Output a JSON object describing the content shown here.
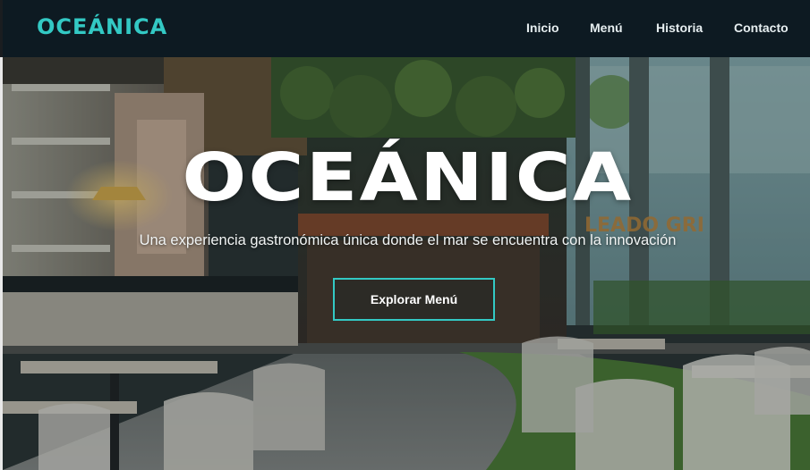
{
  "brand": {
    "logo": "OCEÁNICA",
    "accent_color": "#33c9c4"
  },
  "nav": {
    "items": [
      {
        "label": "Inicio"
      },
      {
        "label": "Menú"
      },
      {
        "label": "Historia"
      },
      {
        "label": "Contacto"
      }
    ]
  },
  "hero": {
    "title": "OCEÁNICA",
    "subtitle": "Una experiencia gastronómica única donde el mar se encuentra con la innovación",
    "cta_label": "Explorar Menú",
    "background": "restaurant-interior-photo",
    "background_sign": "LEADO GRI"
  }
}
